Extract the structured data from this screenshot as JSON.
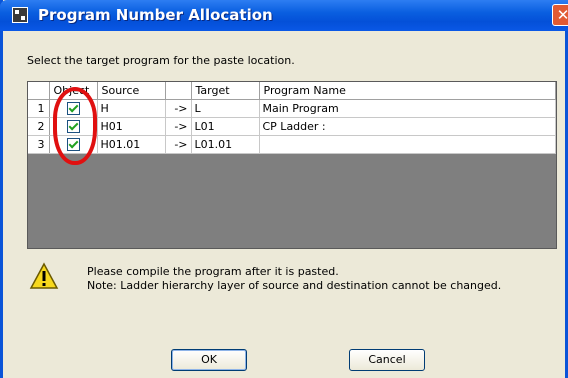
{
  "window": {
    "title": "Program Number Allocation",
    "close_glyph": "✕"
  },
  "instruction": "Select the target program for the paste location.",
  "table": {
    "columns": [
      "",
      "Object",
      "Source",
      "",
      "Target",
      "Program Name"
    ],
    "rows": [
      {
        "num": "1",
        "checked": true,
        "source": "H",
        "arrow": "->",
        "target": "L",
        "program_name": "Main Program"
      },
      {
        "num": "2",
        "checked": true,
        "source": "H01",
        "arrow": "->",
        "target": "L01",
        "program_name": "CP Ladder :"
      },
      {
        "num": "3",
        "checked": true,
        "source": "H01.01",
        "arrow": "->",
        "target": "L01.01",
        "program_name": ""
      }
    ]
  },
  "message": {
    "icon": "warning-icon",
    "line1": "Please compile the program after it is pasted.",
    "line2": "Note: Ladder hierarchy layer of source and destination cannot be changed."
  },
  "buttons": {
    "ok": "OK",
    "cancel": "Cancel"
  },
  "colors": {
    "titlebar": "#0a5fe0",
    "annotation_circle": "#e01010",
    "check": "#21a121"
  }
}
